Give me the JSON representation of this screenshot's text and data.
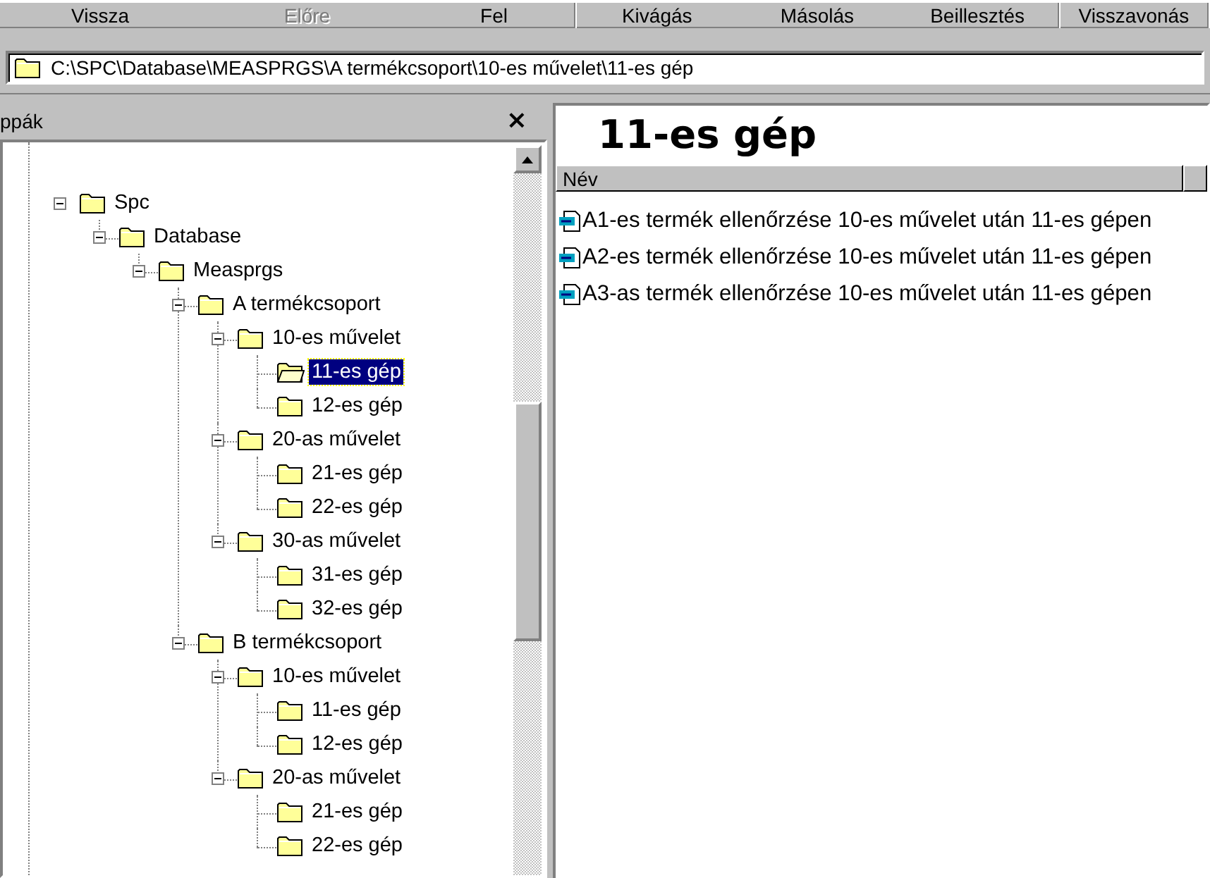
{
  "toolbar": {
    "buttons": [
      {
        "label": "Vissza",
        "disabled": false
      },
      {
        "label": "Előre",
        "disabled": true
      },
      {
        "label": "Fel",
        "disabled": false
      },
      {
        "label": "Kivágás",
        "disabled": false,
        "separator_before": true
      },
      {
        "label": "Másolás",
        "disabled": false
      },
      {
        "label": "Beillesztés",
        "disabled": false
      },
      {
        "label": "Visszavonás",
        "disabled": false,
        "separator_before": true
      }
    ]
  },
  "address": {
    "path": "C:\\SPC\\Database\\MEASPRGS\\A termékcsoport\\10-es művelet\\11-es gép"
  },
  "folders_panel": {
    "title": "ppák",
    "close": "×",
    "tree": [
      {
        "label": "Spc",
        "expanded": true,
        "selected": false,
        "children": [
          {
            "label": "Database",
            "expanded": true,
            "selected": false,
            "children": [
              {
                "label": "Measprgs",
                "expanded": true,
                "selected": false,
                "children": [
                  {
                    "label": "A termékcsoport",
                    "expanded": true,
                    "selected": false,
                    "children": [
                      {
                        "label": "10-es művelet",
                        "expanded": true,
                        "selected": false,
                        "children": [
                          {
                            "label": "11-es gép",
                            "selected": true
                          },
                          {
                            "label": "12-es gép",
                            "selected": false
                          }
                        ]
                      },
                      {
                        "label": "20-as művelet",
                        "expanded": true,
                        "selected": false,
                        "children": [
                          {
                            "label": "21-es gép",
                            "selected": false
                          },
                          {
                            "label": "22-es gép",
                            "selected": false
                          }
                        ]
                      },
                      {
                        "label": "30-as művelet",
                        "expanded": true,
                        "selected": false,
                        "children": [
                          {
                            "label": "31-es gép",
                            "selected": false
                          },
                          {
                            "label": "32-es gép",
                            "selected": false
                          }
                        ]
                      }
                    ]
                  },
                  {
                    "label": "B termékcsoport",
                    "expanded": true,
                    "selected": false,
                    "children": [
                      {
                        "label": "10-es művelet",
                        "expanded": true,
                        "selected": false,
                        "children": [
                          {
                            "label": "11-es gép",
                            "selected": false
                          },
                          {
                            "label": "12-es gép",
                            "selected": false
                          }
                        ]
                      },
                      {
                        "label": "20-as művelet",
                        "expanded": true,
                        "selected": false,
                        "children": [
                          {
                            "label": "21-es gép",
                            "selected": false
                          },
                          {
                            "label": "22-es gép",
                            "selected": false
                          }
                        ]
                      }
                    ]
                  }
                ]
              }
            ]
          }
        ]
      }
    ]
  },
  "content": {
    "title": "11-es gép",
    "columns": [
      "Név"
    ],
    "files": [
      {
        "name": "A1-es termék ellenőrzése 10-es művelet után 11-es gépen"
      },
      {
        "name": "A2-es termék ellenőrzése 10-es művelet után 11-es gépen"
      },
      {
        "name": "A3-as termék ellenőrzése 10-es művelet után 11-es gépen"
      }
    ]
  }
}
